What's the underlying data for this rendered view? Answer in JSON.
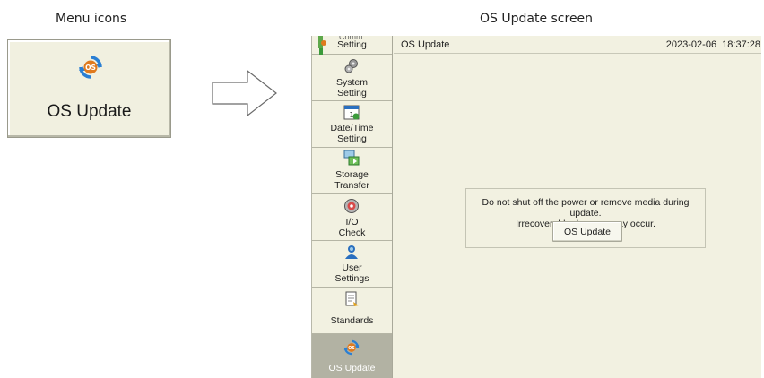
{
  "captions": {
    "left": "Menu icons",
    "right": "OS Update screen"
  },
  "menu_icon": {
    "label": "OS Update",
    "icon": "os-update-icon"
  },
  "sidebar": {
    "items": [
      {
        "label": "Comm.\nSetting",
        "icon": "comm-setting-icon"
      },
      {
        "label": "System\nSetting",
        "icon": "gear-icon"
      },
      {
        "label": "Date/Time\nSetting",
        "icon": "calendar-icon"
      },
      {
        "label": "Storage\nTransfer",
        "icon": "storage-transfer-icon"
      },
      {
        "label": "I/O\nCheck",
        "icon": "io-check-icon"
      },
      {
        "label": "User\nSettings",
        "icon": "user-icon"
      },
      {
        "label": "Standards",
        "icon": "document-icon"
      },
      {
        "label": "OS Update",
        "icon": "os-update-icon"
      }
    ],
    "active_index": 7
  },
  "header": {
    "title": "OS Update",
    "datetime": "2023-02-06  18:37:28"
  },
  "dialog": {
    "line1": "Do not shut off the power or remove media during update.",
    "line2": "Irrecoverable damage may occur.",
    "button_label": "OS Update"
  },
  "colors": {
    "panel_bg": "#f2f1e1",
    "active_item_bg": "#b2b2a3",
    "os_icon_blue": "#2a7fd4",
    "os_icon_orange": "#e07a1e"
  }
}
